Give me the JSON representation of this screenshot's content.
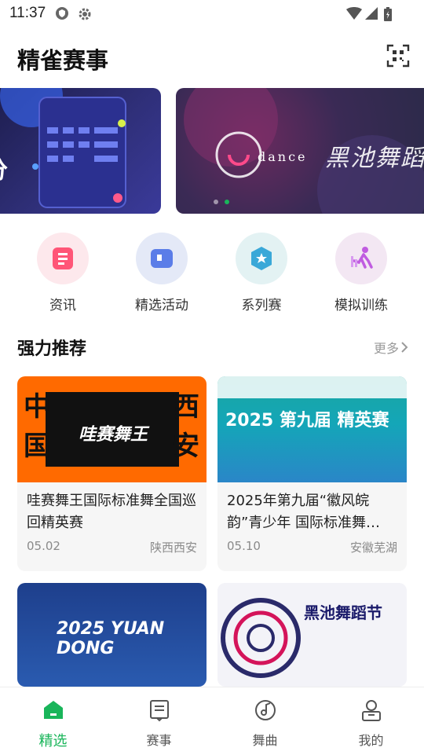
{
  "status_bar": {
    "time": "11:37"
  },
  "header": {
    "title": "精雀赛事",
    "scan_icon": "scan-icon"
  },
  "banners": {
    "left_text": "分",
    "right_text": "黑池舞蹈",
    "right_logo": "dance",
    "active_index": 1
  },
  "quick_nav": [
    {
      "label": "资讯",
      "icon": "news-icon",
      "bg": "#fde8ec",
      "color": "#ff5577"
    },
    {
      "label": "精选活动",
      "icon": "activity-icon",
      "bg": "#e4e9f7",
      "color": "#5b7de8"
    },
    {
      "label": "系列赛",
      "icon": "series-icon",
      "bg": "#e3f2f3",
      "color": "#3aa8d8"
    },
    {
      "label": "模拟训练",
      "icon": "training-icon",
      "bg": "#f3e7f3",
      "color": "#c05ce0"
    }
  ],
  "recommend": {
    "title": "强力推荐",
    "more": "更多",
    "cards": [
      {
        "title": "哇赛舞王国际标准舞全国巡回精英赛",
        "date": "05.02",
        "location": "陕西西安",
        "img_text": "哇赛舞王"
      },
      {
        "title": "2025年第九届“徽风皖韵”青少年 国际标准舞…",
        "date": "05.10",
        "location": "安徽芜湖",
        "img_text": "2025 第九届 精英赛"
      },
      {
        "title": "",
        "date": "",
        "location": "",
        "img_text": "2025 YUAN DONG"
      },
      {
        "title": "",
        "date": "",
        "location": "",
        "img_text": "黑池舞蹈节"
      }
    ]
  },
  "tabs": [
    {
      "label": "精选",
      "icon": "home-icon",
      "active": true
    },
    {
      "label": "赛事",
      "icon": "events-icon",
      "active": false
    },
    {
      "label": "舞曲",
      "icon": "music-icon",
      "active": false
    },
    {
      "label": "我的",
      "icon": "profile-icon",
      "active": false
    }
  ],
  "colors": {
    "accent": "#19b55a",
    "card_bg": "#f6f6f6",
    "muted": "#8a8a8a"
  }
}
